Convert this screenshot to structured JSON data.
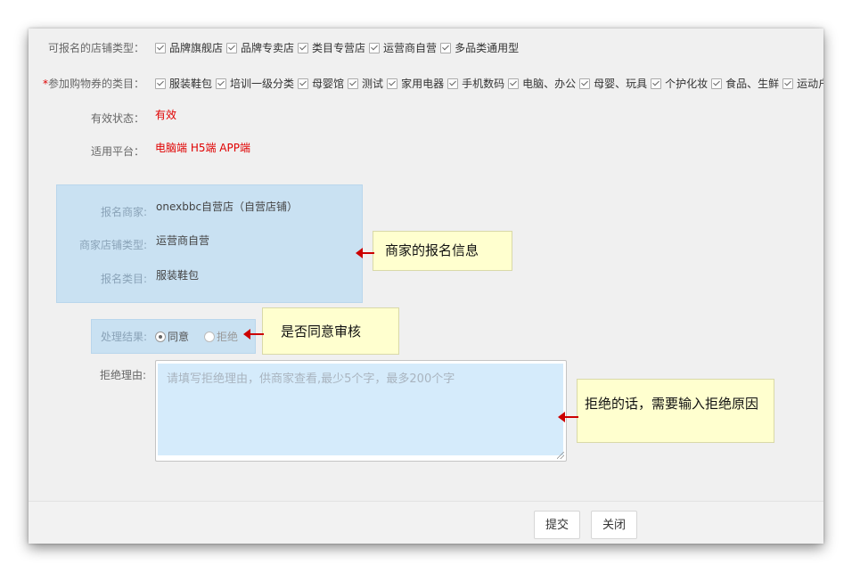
{
  "form": {
    "store_types": {
      "label": "可报名的店铺类型：",
      "options": [
        "品牌旗舰店",
        "品牌专卖店",
        "类目专营店",
        "运营商自营",
        "多品类通用型"
      ]
    },
    "categories": {
      "required_mark": "*",
      "label": "参加购物券的类目：",
      "options": [
        "服装鞋包",
        "培训一级分类",
        "母婴馆",
        "测试",
        "家用电器",
        "手机数码",
        "电脑、办公",
        "母婴、玩具",
        "个护化妆",
        "食品、生鲜",
        "运动户"
      ]
    },
    "status": {
      "label": "有效状态：",
      "value": "有效"
    },
    "platform": {
      "label": "适用平台：",
      "value": "电脑端 H5端 APP端"
    }
  },
  "merchant_info": {
    "merchant": {
      "label": "报名商家:",
      "value": "onexbbc自营店（自营店铺）"
    },
    "store_type": {
      "label": "商家店铺类型:",
      "value": "运营商自营"
    },
    "category": {
      "label": "报名类目:",
      "value": "服装鞋包"
    }
  },
  "result": {
    "label": "处理结果:",
    "agree": "同意",
    "reject": "拒绝",
    "selected": "同意"
  },
  "reject_reason": {
    "label": "拒绝理由:",
    "placeholder": "请填写拒绝理由，供商家查看,最少5个字，最多200个字",
    "value": ""
  },
  "buttons": {
    "submit": "提交",
    "close": "关闭"
  },
  "callouts": {
    "merchant_info": "商家的报名信息",
    "approve": "是否同意审核",
    "reject": "拒绝的话，需要输入拒绝原因"
  },
  "colors": {
    "highlight_bg": "#c9e1f2",
    "callout_bg": "#ffffcf",
    "arrow": "#cc0000",
    "value_red": "#e00000"
  }
}
